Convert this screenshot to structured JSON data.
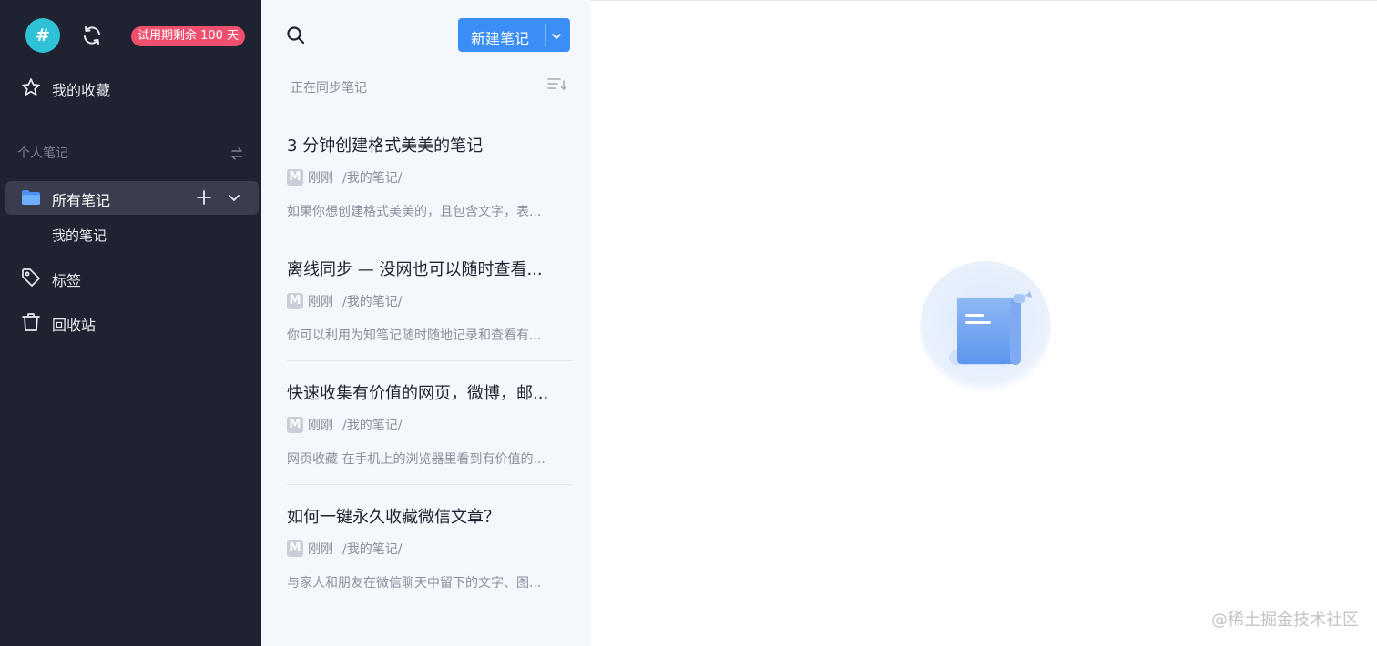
{
  "colors": {
    "sidebar_bg": "#1f2230",
    "sidebar_active": "#393d4d",
    "accent": "#3a8ef6",
    "badge": "#f0506e",
    "avatar": "#2fc1d6",
    "list_bg": "#f4f7fb"
  },
  "sidebar": {
    "avatar_char": "#",
    "trial_badge": "试用期剩余 100 天",
    "favorites_label": "我的收藏",
    "section_title": "个人笔记",
    "all_notes_label": "所有笔记",
    "sub_folder_label": "我的笔记",
    "tags_label": "标签",
    "trash_label": "回收站",
    "icons": [
      "sync-icon",
      "star-icon",
      "swap-icon",
      "folder-icon",
      "plus-icon",
      "chevron-down-icon",
      "tag-icon",
      "trash-icon"
    ]
  },
  "notelist": {
    "new_note_label": "新建笔记",
    "sync_status": "正在同步笔记",
    "notes": [
      {
        "title": "3 分钟创建格式美美的笔记",
        "source_letter": "M",
        "time": "刚刚",
        "path": "/我的笔记/",
        "snippet": "如果你想创建格式美美的，且包含文字，表..."
      },
      {
        "title": "离线同步 — 没网也可以随时查看...",
        "source_letter": "M",
        "time": "刚刚",
        "path": "/我的笔记/",
        "snippet": "你可以利用为知笔记随时随地记录和查看有..."
      },
      {
        "title": "快速收集有价值的网页，微博，邮...",
        "source_letter": "M",
        "time": "刚刚",
        "path": "/我的笔记/",
        "snippet": "网页收藏 在手机上的浏览器里看到有价值的..."
      },
      {
        "title": "如何一键永久收藏微信文章？",
        "source_letter": "M",
        "time": "刚刚",
        "path": "/我的笔记/",
        "snippet": "与家人和朋友在微信聊天中留下的文字、图..."
      }
    ]
  },
  "editor": {
    "empty_illustration": "scroll-document-icon",
    "watermark": "@稀土掘金技术社区"
  }
}
